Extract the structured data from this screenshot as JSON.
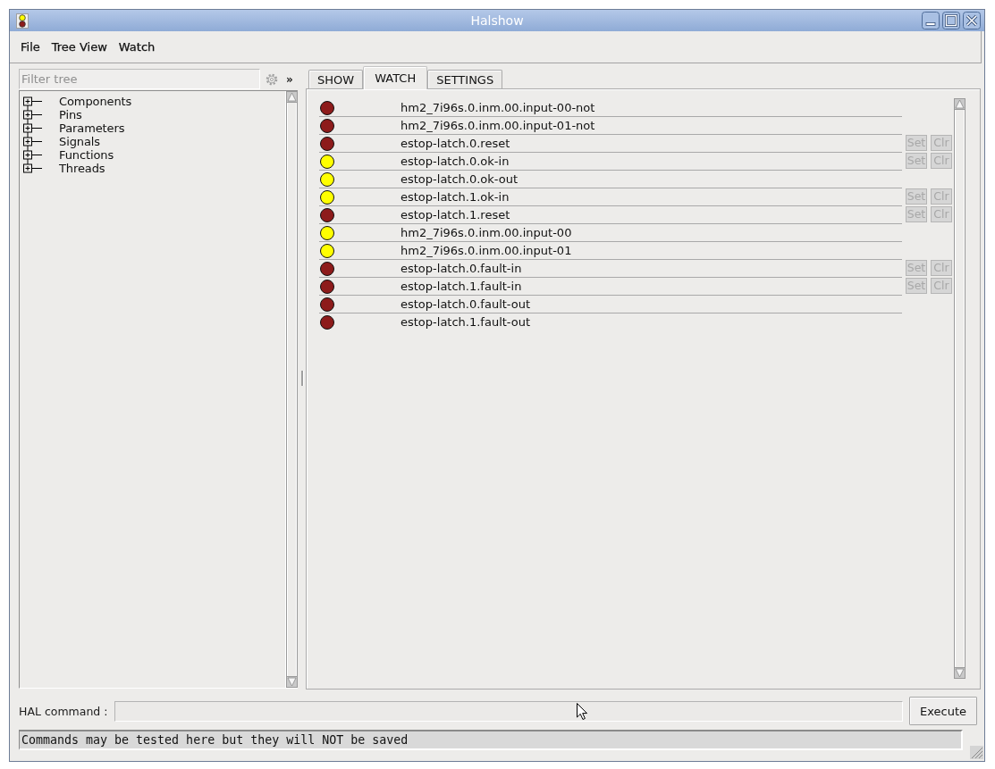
{
  "window": {
    "title": "Halshow"
  },
  "menu": [
    "File",
    "Tree View",
    "Watch"
  ],
  "sidebar": {
    "filter": {
      "placeholder": "Filter tree"
    },
    "expand_button": "»",
    "tree": [
      {
        "label": "Components",
        "expanded": false
      },
      {
        "label": "Pins",
        "expanded": false
      },
      {
        "label": "Parameters",
        "expanded": false
      },
      {
        "label": "Signals",
        "expanded": false
      },
      {
        "label": "Functions",
        "expanded": false
      },
      {
        "label": "Threads",
        "expanded": false
      }
    ]
  },
  "tabs": [
    {
      "label": "SHOW",
      "selected": false
    },
    {
      "label": "WATCH",
      "selected": true
    },
    {
      "label": "SETTINGS",
      "selected": false
    }
  ],
  "watch": [
    {
      "name": "hm2_7i96s.0.inm.00.input-00-not",
      "on": false
    },
    {
      "name": "hm2_7i96s.0.inm.00.input-01-not",
      "on": false
    },
    {
      "name": "estop-latch.0.reset",
      "on": false,
      "buttons": [
        {
          "label": "Set",
          "disabled": true
        },
        {
          "label": "Clr",
          "disabled": true
        }
      ]
    },
    {
      "name": "estop-latch.0.ok-in",
      "on": true,
      "buttons": [
        {
          "label": "Set",
          "disabled": true
        },
        {
          "label": "Clr",
          "disabled": true
        }
      ]
    },
    {
      "name": "estop-latch.0.ok-out",
      "on": true
    },
    {
      "name": "estop-latch.1.ok-in",
      "on": true,
      "buttons": [
        {
          "label": "Set",
          "disabled": true
        },
        {
          "label": "Clr",
          "disabled": true
        }
      ]
    },
    {
      "name": "estop-latch.1.reset",
      "on": false,
      "buttons": [
        {
          "label": "Set",
          "disabled": true
        },
        {
          "label": "Clr",
          "disabled": true
        }
      ]
    },
    {
      "name": "hm2_7i96s.0.inm.00.input-00",
      "on": true
    },
    {
      "name": "hm2_7i96s.0.inm.00.input-01",
      "on": true
    },
    {
      "name": "estop-latch.0.fault-in",
      "on": false,
      "buttons": [
        {
          "label": "Set",
          "disabled": true
        },
        {
          "label": "Clr",
          "disabled": true
        }
      ]
    },
    {
      "name": "estop-latch.1.fault-in",
      "on": false,
      "buttons": [
        {
          "label": "Set",
          "disabled": true
        },
        {
          "label": "Clr",
          "disabled": true
        }
      ]
    },
    {
      "name": "estop-latch.0.fault-out",
      "on": false
    },
    {
      "name": "estop-latch.1.fault-out",
      "on": false
    }
  ],
  "command": {
    "label": "HAL command :",
    "execute_button": "Execute"
  },
  "status": "Commands may be tested here but they will NOT be saved"
}
